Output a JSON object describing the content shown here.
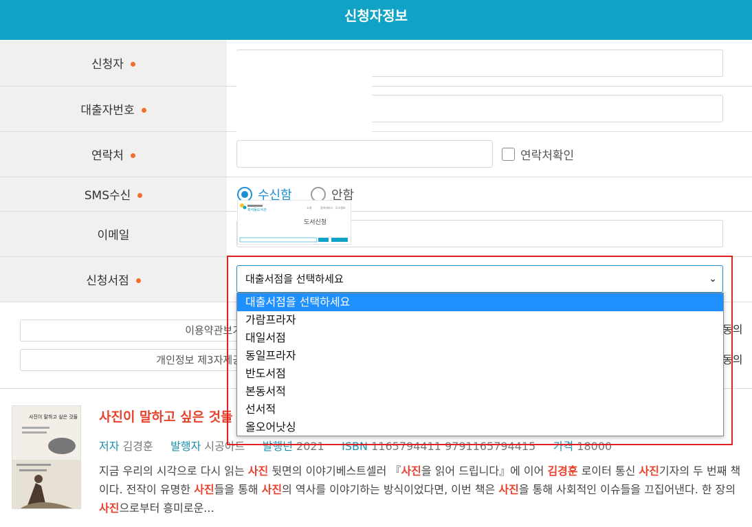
{
  "header": {
    "title": "신청자정보"
  },
  "form": {
    "applicant_label": "신청자",
    "card_number_label": "대출자번호",
    "phone_label": "연락처",
    "phone_check_label": "연락처확인",
    "sms_label": "SMS수신",
    "sms_options": [
      "수신함",
      "안함"
    ],
    "sms_selected": "수신함",
    "email_label": "이메일",
    "bookstore_label": "신청서점",
    "bookstore_selected": "대출서점을 선택하세요"
  },
  "dropdown": {
    "options": [
      "대출서점을 선택하세요",
      "가람프라자",
      "대일서점",
      "동일프라자",
      "반도서점",
      "본동서적",
      "선서적",
      "올오어낫싱"
    ]
  },
  "thumbnail": {
    "library_name": "흑석동도서관",
    "nav": [
      "소개",
      "참여서비스",
      "도서정보"
    ],
    "title": "도서신청"
  },
  "agreement": {
    "terms_button": "이용약관보기",
    "third_party_button": "개인정보 제3자제공",
    "agree_label": "동의"
  },
  "book": {
    "cover_title": "사진이 말하고 싶은 것들",
    "title": "사진이 말하고 싶은 것들",
    "author_label": "저자",
    "author": "김경훈",
    "publisher_label": "발행자",
    "publisher": "시공아트",
    "year_label": "발행년",
    "year": "2021",
    "isbn_label": "ISBN",
    "isbn": "1165794411 9791165794415",
    "price_label": "가격",
    "price": "18000",
    "desc_parts": [
      "지금 우리의 시각으로 다시 읽는 ",
      "사진",
      " 뒷면의 이야기베스트셀러 『",
      "사진",
      "을 읽어 드립니다』에 이어 ",
      "김경훈",
      " 로이터 통신 ",
      "사진",
      "기자의 두 번째 책이다. 전작이 유명한 ",
      "사진",
      "들을 통해 ",
      "사진",
      "의 역사를 이야기하는 방식이었다면, 이번 책은 ",
      "사진",
      "을 통해 사회적인 이슈들을 끄집어낸다. 한 장의 ",
      "사진",
      "으로부터 흥미로운..."
    ]
  },
  "colors": {
    "header": "#11a3c5",
    "required_dot": "#f0702c",
    "accent": "#1a8fd6",
    "highlight": "#e8412c",
    "frame": "#e02020"
  }
}
